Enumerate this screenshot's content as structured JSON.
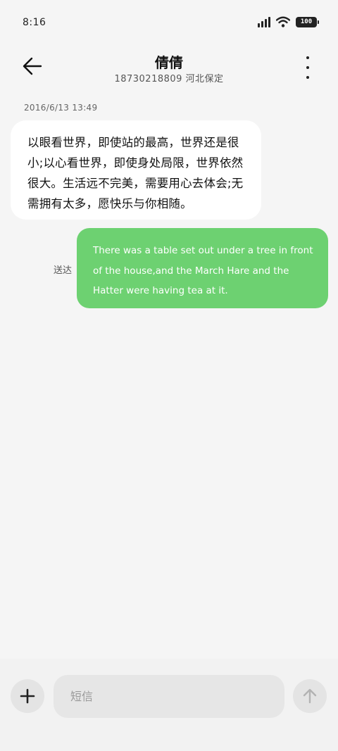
{
  "status_bar": {
    "time": "8:16",
    "battery": "100",
    "icons": [
      "signal-icon",
      "wifi-icon",
      "battery-icon"
    ]
  },
  "header": {
    "contact_name": "倩倩",
    "contact_detail": "18730218809 河北保定",
    "icons": [
      "back-arrow-icon",
      "more-vertical-icon"
    ]
  },
  "conversation": {
    "timestamp": "2016/6/13 13:49",
    "incoming_message": "以眼看世界，即使站的最高，世界还是很小;以心看世界，即使身处局限，世界依然很大。生活远不完美，需要用心去体会;无需拥有太多，愿快乐与你相随。",
    "outgoing_message": "There was a table set out under a tree in front of the house,and the March Hare and the Hatter were having tea at it.",
    "outgoing_status": "送达"
  },
  "composer": {
    "placeholder": "短信",
    "icons": [
      "plus-icon",
      "send-arrow-icon"
    ]
  },
  "colors": {
    "background": "#f5f5f5",
    "incoming_bubble": "#ffffff",
    "outgoing_bubble": "#6dd171",
    "input_background": "#e6e6e6"
  }
}
